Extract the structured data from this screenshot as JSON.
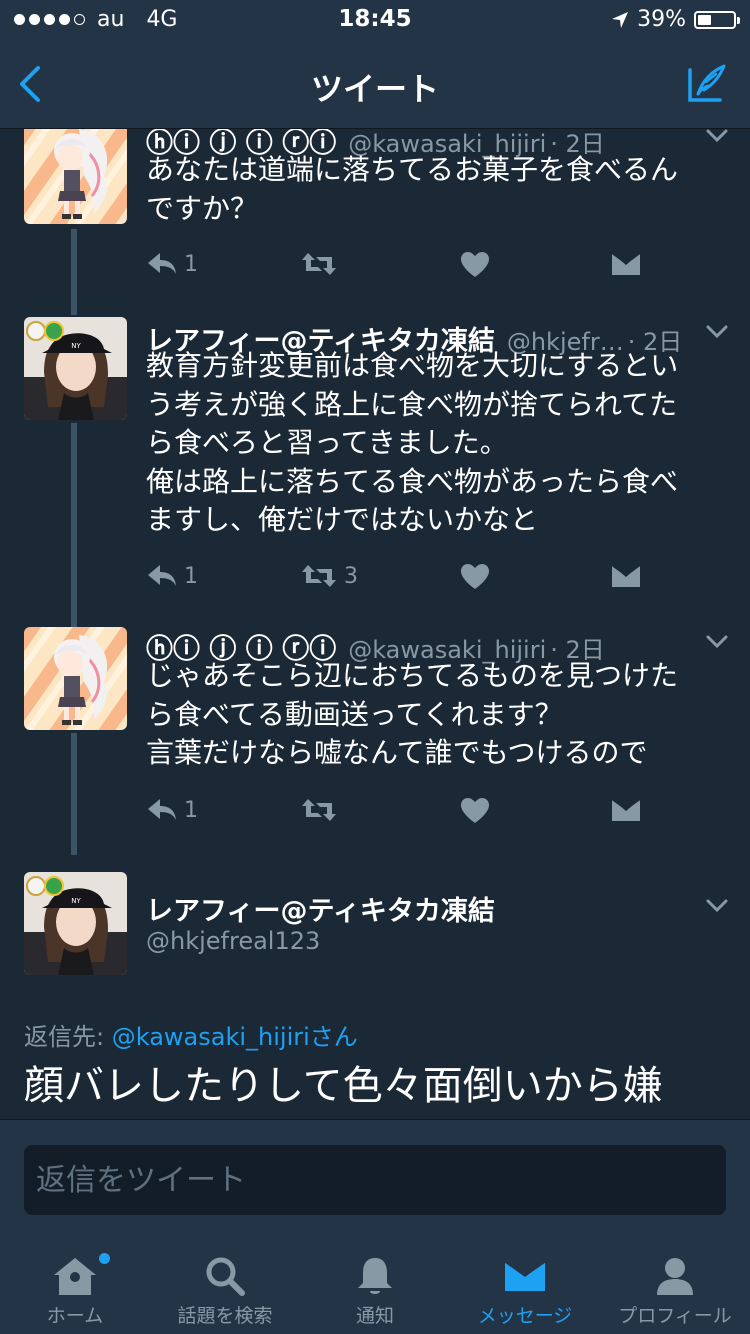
{
  "status_bar": {
    "carrier": "au",
    "network": "4G",
    "time": "18:45",
    "battery_percent": "39%",
    "battery_level": 0.39,
    "signal_bars_filled": 4,
    "signal_bars_total": 5
  },
  "nav": {
    "title": "ツイート",
    "back_icon": "chevron-left-icon",
    "compose_icon": "compose-quill-icon"
  },
  "colors": {
    "background": "#1b2836",
    "bar": "#243447",
    "accent": "#1da1f2",
    "secondary_text": "#8899a6"
  },
  "tweets": [
    {
      "name": "ⓗⓘ ⓙ ⓘ ⓡⓘ",
      "handle": "@kawasaki_hijiri",
      "time": "· 2日",
      "text": [
        "あなたは道端に落ちてるお菓子を食べるん",
        "ですか？"
      ],
      "reply_count": "1",
      "retweet_count": "",
      "avatar": "anime-girl-avatar"
    },
    {
      "name": "レアフィー@ティキタカ凍結",
      "handle": "@hkjefr…",
      "time": "· 2日",
      "text": [
        "教育方針変更前は食べ物を大切にするとい",
        "う考えが強く路上に食べ物が捨てられてた",
        "ら食べろと習ってきました。",
        "俺は路上に落ちてる食べ物があったら食べ",
        "ますし、俺だけではないかなと"
      ],
      "reply_count": "1",
      "retweet_count": "3",
      "avatar": "photo-girl-cap-avatar"
    },
    {
      "name": "ⓗⓘ ⓙ ⓘ ⓡⓘ",
      "handle": "@kawasaki_hijiri",
      "time": "· 2日",
      "text": [
        "じゃあそこら辺におちてるものを見つけた",
        "ら食べてる動画送ってくれます？",
        "言葉だけなら嘘なんて誰でもつけるので"
      ],
      "reply_count": "1",
      "retweet_count": "",
      "avatar": "anime-girl-avatar"
    }
  ],
  "focus_tweet": {
    "name": "レアフィー@ティキタカ凍結",
    "handle": "@hkjefreal123",
    "reply_prefix": "返信先: ",
    "reply_target": "@kawasaki_hijiriさん",
    "text": "顔バレしたりして色々面倒いから嫌"
  },
  "reply_box": {
    "placeholder": "返信をツイート"
  },
  "tab_bar": {
    "tabs": [
      {
        "label": "ホーム",
        "icon": "home-icon"
      },
      {
        "label": "話題を検索",
        "icon": "search-icon"
      },
      {
        "label": "通知",
        "icon": "bell-icon"
      },
      {
        "label": "メッセージ",
        "icon": "envelope-icon"
      },
      {
        "label": "プロフィール",
        "icon": "person-icon"
      }
    ],
    "active_tab": "メッセージ"
  }
}
